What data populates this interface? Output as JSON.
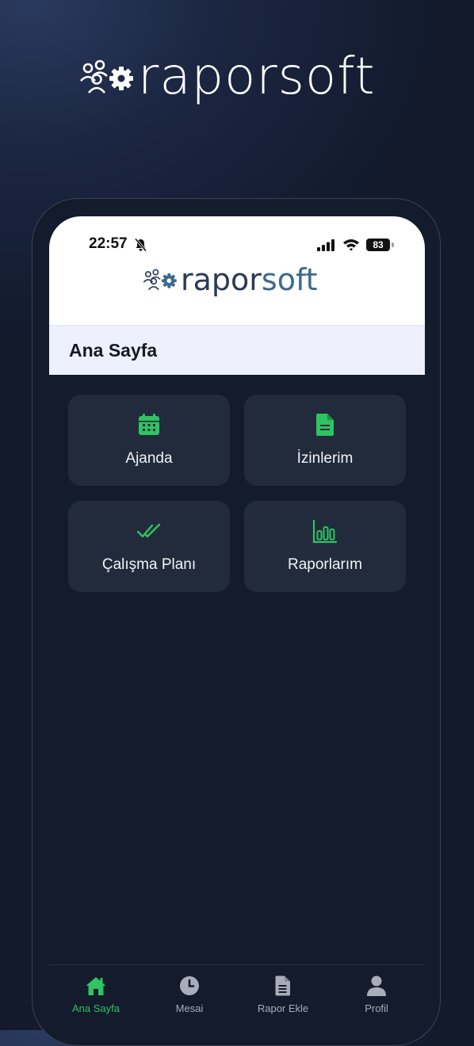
{
  "promo": {
    "logo_text": "raporsoft"
  },
  "status_bar": {
    "time": "22:57",
    "battery": "83"
  },
  "app_header": {
    "logo_text_a": "rapor",
    "logo_text_b": "soft"
  },
  "page": {
    "title": "Ana Sayfa"
  },
  "tiles": [
    {
      "label": "Ajanda",
      "icon": "calendar-icon"
    },
    {
      "label": "İzinlerim",
      "icon": "document-icon"
    },
    {
      "label": "Çalışma Planı",
      "icon": "double-check-icon"
    },
    {
      "label": "Raporlarım",
      "icon": "bar-chart-icon"
    }
  ],
  "tab_bar": {
    "items": [
      {
        "label": "Ana Sayfa",
        "icon": "home-icon",
        "active": true
      },
      {
        "label": "Mesai",
        "icon": "clock-icon",
        "active": false
      },
      {
        "label": "Rapor Ekle",
        "icon": "file-text-icon",
        "active": false
      },
      {
        "label": "Profil",
        "icon": "user-icon",
        "active": false
      }
    ]
  },
  "colors": {
    "accent_green": "#2ec461",
    "background": "#131b2d",
    "tile": "#222b3b",
    "header_bg": "#ffffff",
    "title_bar_bg": "#eef1fb",
    "logo_dark": "#2b3a55",
    "logo_blue": "#3d6a8c"
  }
}
